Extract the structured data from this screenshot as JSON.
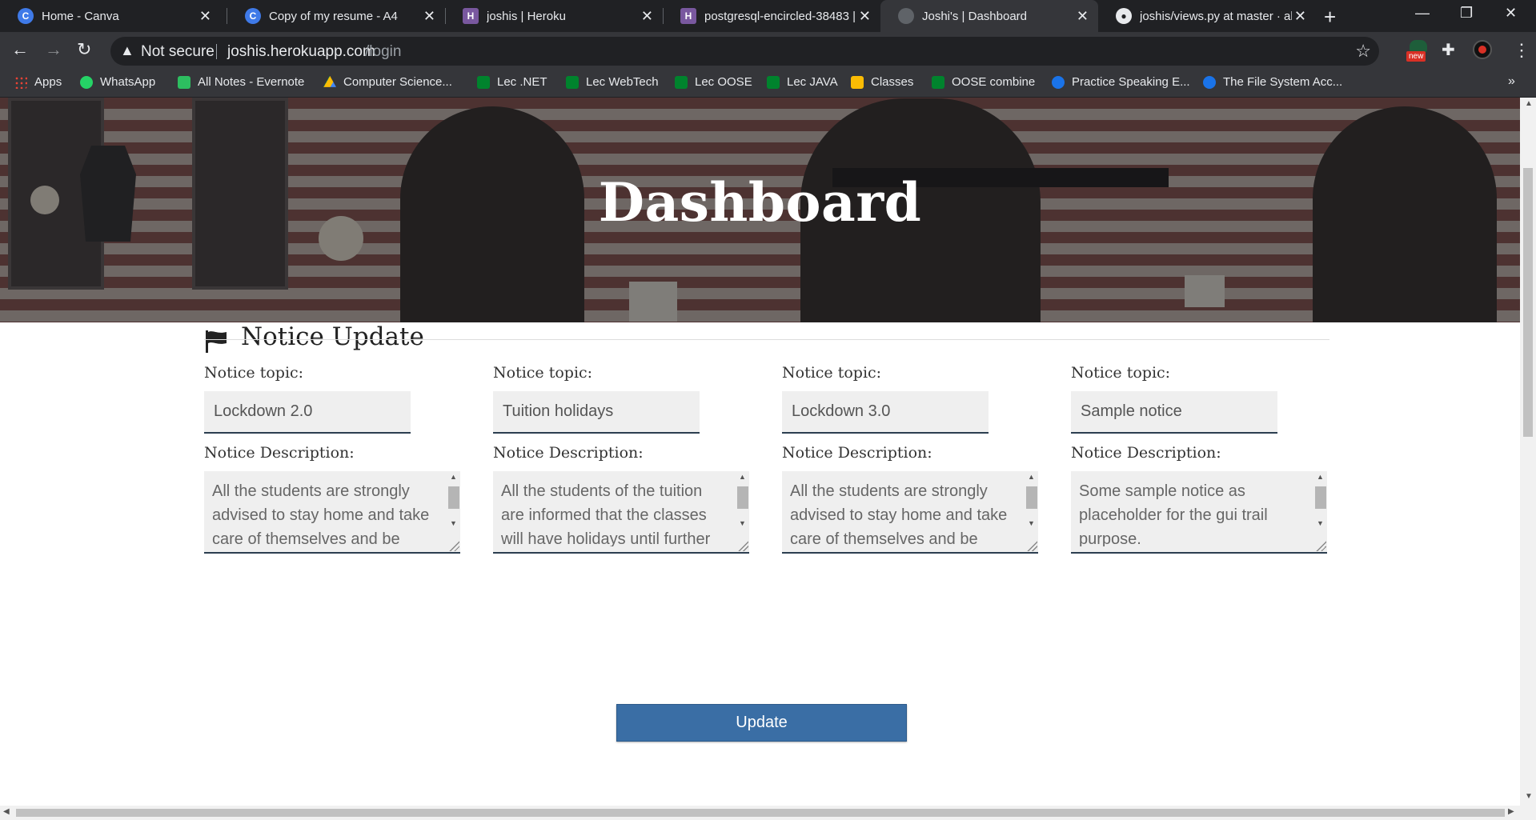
{
  "browser": {
    "tabs": [
      {
        "title": "Home - Canva",
        "favicon": "canva-icon",
        "color": "#3f7ae8",
        "glyph": "C"
      },
      {
        "title": "Copy of my resume - A4",
        "favicon": "canva-icon",
        "color": "#3f7ae8",
        "glyph": "C"
      },
      {
        "title": "joshis | Heroku",
        "favicon": "heroku-icon",
        "color": "#79589f",
        "glyph": "H"
      },
      {
        "title": "postgresql-encircled-38483 |",
        "favicon": "heroku-icon",
        "color": "#79589f",
        "glyph": "H"
      },
      {
        "title": "Joshi's | Dashboard",
        "favicon": "globe-icon",
        "color": "#5f6368",
        "glyph": ""
      },
      {
        "title": "joshis/views.py at master · ab",
        "favicon": "github-icon",
        "color": "#202124",
        "glyph": ""
      }
    ],
    "active_tab": 4,
    "address": {
      "security_label": "Not secure",
      "host": "joshis.herokuapp.com",
      "path": "/login"
    },
    "extension_badge": "new",
    "bookmarks": [
      {
        "label": "Apps",
        "icon": "apps-grid-icon",
        "color": "#ea4335"
      },
      {
        "label": "WhatsApp",
        "icon": "whatsapp-icon",
        "color": "#25d366"
      },
      {
        "label": "All Notes - Evernote",
        "icon": "evernote-icon",
        "color": "#2dbe60"
      },
      {
        "label": "Computer Science...",
        "icon": "google-drive-icon",
        "color": "#fbbc04"
      },
      {
        "label": "Lec .NET",
        "icon": "google-meet-icon",
        "color": "#00832d"
      },
      {
        "label": "Lec WebTech",
        "icon": "google-meet-icon",
        "color": "#00832d"
      },
      {
        "label": "Lec OOSE",
        "icon": "google-meet-icon",
        "color": "#00832d"
      },
      {
        "label": "Lec JAVA",
        "icon": "google-meet-icon",
        "color": "#00832d"
      },
      {
        "label": "Classes",
        "icon": "google-classroom-icon",
        "color": "#fbbc04"
      },
      {
        "label": "OOSE combine",
        "icon": "google-meet-icon",
        "color": "#00832d"
      },
      {
        "label": "Practice Speaking E...",
        "icon": "circle-blue-icon",
        "color": "#1a73e8"
      },
      {
        "label": "The File System Acc...",
        "icon": "chrome-lab-icon",
        "color": "#1a73e8"
      }
    ]
  },
  "page": {
    "hero_title": "Dashboard",
    "section_title": "Notice Update",
    "topic_label": "Notice topic:",
    "description_label": "Notice Description:",
    "notices": [
      {
        "topic": "Lockdown 2.0",
        "description": "All the students are strongly advised to stay home and take care of themselves and be"
      },
      {
        "topic": "Tuition holidays",
        "description": "All the students of the tuition are informed that the classes will have holidays until further"
      },
      {
        "topic": "Lockdown 3.0",
        "description": "All the students are strongly advised to stay home and take care of themselves and be"
      },
      {
        "topic": "Sample notice",
        "description": "Some sample notice as placeholder for the gui trail purpose."
      }
    ],
    "update_label": "Update"
  },
  "colors": {
    "chrome_dark": "#202124",
    "chrome_mid": "#35363a",
    "button_blue": "#3a6ea5",
    "input_underline": "#2c3e50"
  }
}
